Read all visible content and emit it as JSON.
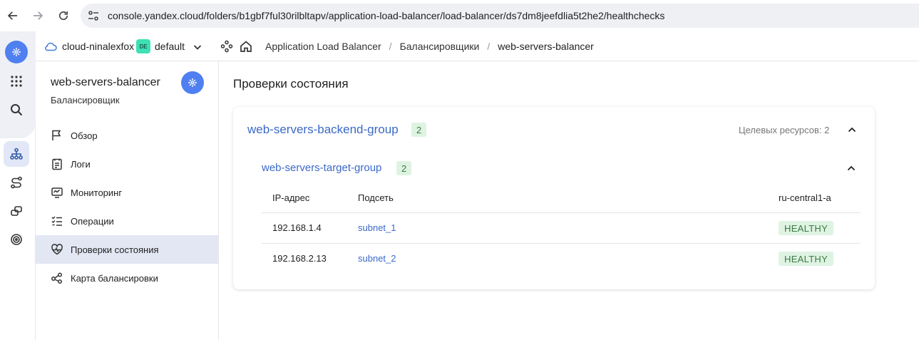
{
  "browser": {
    "url": "console.yandex.cloud/folders/b1gbf7ful30rilbltapv/application-load-balancer/load-balancer/ds7dm8jeefdlia5t2he2/healthchecks"
  },
  "header": {
    "cloud": "cloud-ninalexfox",
    "folder_badge": "DE",
    "folder": "default",
    "breadcrumbs": [
      "Application Load Balancer",
      "Балансировщики",
      "web-servers-balancer"
    ]
  },
  "sidebar": {
    "title": "web-servers-balancer",
    "subtitle": "Балансировщик",
    "items": [
      {
        "label": "Обзор",
        "icon": "flag-icon"
      },
      {
        "label": "Логи",
        "icon": "logs-icon"
      },
      {
        "label": "Мониторинг",
        "icon": "monitor-icon"
      },
      {
        "label": "Операции",
        "icon": "list-check-icon"
      },
      {
        "label": "Проверки состояния",
        "icon": "heartbeat-icon",
        "active": true
      },
      {
        "label": "Карта балансировки",
        "icon": "graph-icon"
      }
    ]
  },
  "main": {
    "title": "Проверки состояния",
    "backend_group": {
      "name": "web-servers-backend-group",
      "count": "2",
      "targets_label": "Целевых ресурсов: 2"
    },
    "target_group": {
      "name": "web-servers-target-group",
      "count": "2"
    },
    "table": {
      "headers": [
        "IP-адрес",
        "Подсеть",
        "ru-central1-a"
      ],
      "rows": [
        {
          "ip": "192.168.1.4",
          "subnet": "subnet_1",
          "status": "HEALTHY"
        },
        {
          "ip": "192.168.2.13",
          "subnet": "subnet_2",
          "status": "HEALTHY"
        }
      ]
    }
  },
  "colors": {
    "accent": "#4f7ff0",
    "link": "#3b69c8",
    "healthy_bg": "#dff3e2",
    "healthy_text": "#3b7a46"
  }
}
